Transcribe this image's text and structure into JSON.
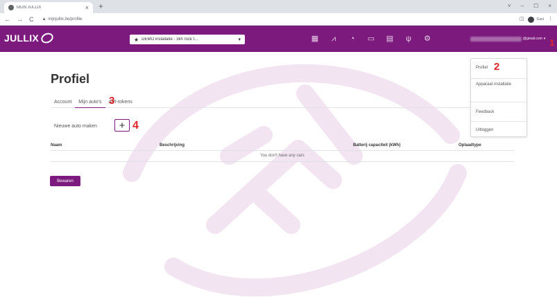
{
  "browser": {
    "tab_title": "MIJN JULLIX",
    "tab_close": "×",
    "new_tab": "+",
    "window_controls": [
      "˅",
      "–",
      "☐",
      "×"
    ],
    "nav_buttons": [
      "←",
      "→",
      "C"
    ],
    "url": "mijnjullix.be/profile",
    "profile_label": "Gast"
  },
  "navbar": {
    "brand": "JULLIX",
    "installation_select": "DEMO installatie - 3kh rock f...",
    "installation_star": "★",
    "installation_caret": "▾",
    "icons": [
      "grid-icon",
      "chart-icon",
      "lightbulb-icon",
      "battery-icon",
      "document-icon",
      "plug-icon",
      "gear-icon"
    ],
    "user_email": "@gmail.com",
    "user_caret": "▾"
  },
  "annotations": {
    "n1": "1",
    "n2": "2",
    "n3": "3",
    "n4": "4"
  },
  "page": {
    "title": "Profiel",
    "tabs": [
      "Account",
      "Mijn auto's",
      "API-tokens"
    ],
    "active_tab": "Mijn auto's",
    "new_car_label": "Nieuwe auto maken",
    "add_button": "+",
    "table": {
      "headers": [
        "Naam",
        "Beschrijving",
        "Batterij capaciteit (kWh)",
        "Oplaadtype"
      ],
      "empty_message": "You don't have any cars"
    },
    "save_button": "Bewaren"
  },
  "dropdown": {
    "items": [
      "Profiel",
      "Apparaat installatie",
      "Feedback",
      "Uitloggen"
    ]
  },
  "colors": {
    "brand_purple": "#7c1a7e",
    "annotation_red": "#e0242b"
  }
}
